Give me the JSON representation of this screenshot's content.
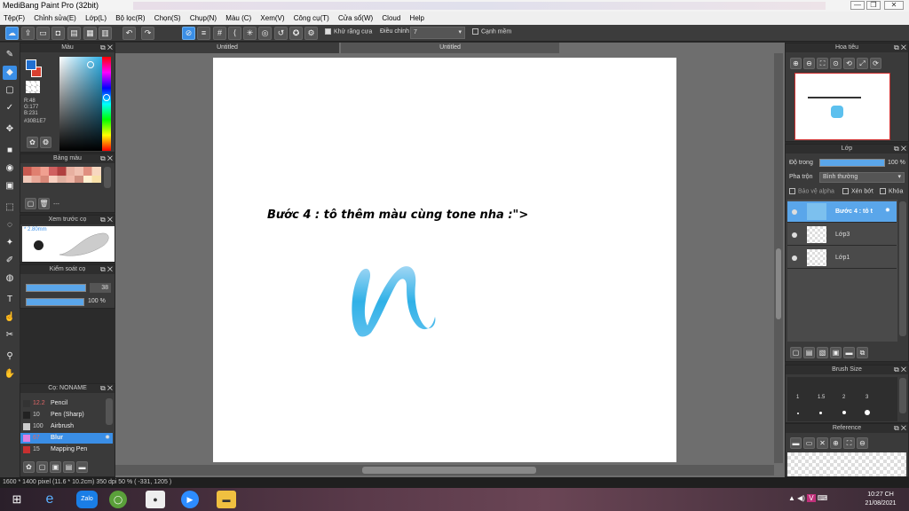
{
  "app": {
    "title": "MediBang Paint Pro (32bit)"
  },
  "window_controls": {
    "minimize": "—",
    "restore": "❐",
    "close": "✕"
  },
  "menu": [
    "Tệp(F)",
    "Chỉnh sửa(E)",
    "Lớp(L)",
    "Bộ lọc(R)",
    "Chọn(S)",
    "Chụp(N)",
    "Màu (C)",
    "Xem(V)",
    "Công cụ(T)",
    "Cửa sổ(W)",
    "Cloud",
    "Help"
  ],
  "toolbar": {
    "antialias_label": "Khử răng cưa",
    "correction_label": "Điều chỉnh",
    "correction_value": "7",
    "snap_label": "Cạnh mềm"
  },
  "color_panel": {
    "title": "Màu",
    "r": "R:48",
    "g": "G:177",
    "b": "B:231",
    "hex": "#30B1E7",
    "primary_color": "#1f6fd0",
    "secondary_color": "#d84030"
  },
  "palette_panel": {
    "title": "Bảng màu",
    "ellipsis": "---"
  },
  "preview_panel": {
    "title": "Xem trước cọ",
    "size": "* 2.80mm"
  },
  "brush_control": {
    "title": "Kiểm soát cọ",
    "size": "38",
    "opacity": "100 %"
  },
  "brush_list": {
    "title": "Cọ: NONAME",
    "items": [
      {
        "size": "12.2",
        "name": "Pencil",
        "color": "#333333"
      },
      {
        "size": "10",
        "name": "Pen (Sharp)",
        "color": "#222222"
      },
      {
        "size": "100",
        "name": "Airbrush",
        "color": "#cccccc"
      },
      {
        "size": "67",
        "name": "Blur",
        "color": "#e080e0"
      },
      {
        "size": "15",
        "name": "Mapping Pen",
        "color": "#c83030"
      }
    ]
  },
  "document": {
    "tabs": [
      "Untitled",
      "Untitled"
    ],
    "text": "Bước 4 : tô thêm màu cùng tone nha :\">",
    "stroke_color": "#30B1E7"
  },
  "navigator": {
    "title": "Hoa tiêu"
  },
  "layers": {
    "title": "Lớp",
    "opacity_label": "Độ trong",
    "opacity_value": "100 %",
    "blend_label": "Pha trộn",
    "blend_value": "Bình thường",
    "protect_alpha": "Bảo vệ alpha",
    "clipping": "Xén bớt",
    "lock": "Khóa",
    "items": [
      {
        "name": "Bước 4 : tô t",
        "selected": true
      },
      {
        "name": "Lớp3",
        "selected": false
      },
      {
        "name": "Lớp1",
        "selected": false
      }
    ]
  },
  "brush_size": {
    "title": "Brush Size",
    "labels": [
      "1",
      "1.5",
      "2",
      "3"
    ]
  },
  "reference": {
    "title": "Reference"
  },
  "status": {
    "text": "1600 * 1400 pixel   (11.6 * 10.2cm)   350 dpi   50 %   ( -331, 1205 )"
  },
  "taskbar": {
    "time": "10:27 CH",
    "date": "21/08/2021",
    "zalo": "Zalo"
  }
}
